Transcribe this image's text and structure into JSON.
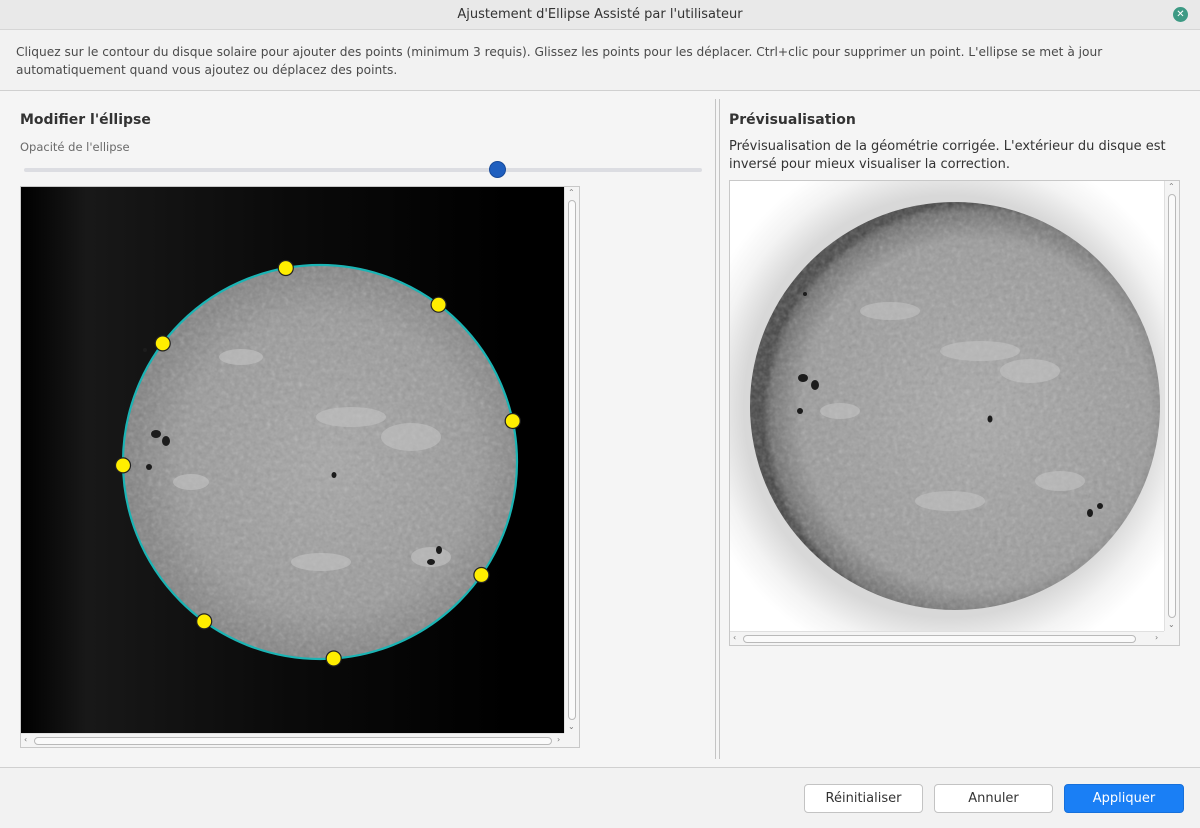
{
  "window": {
    "title": "Ajustement d'Ellipse Assisté par l'utilisateur",
    "close_glyph": "✕"
  },
  "instructions": "Cliquez sur le contour du disque solaire pour ajouter des points (minimum 3 requis). Glissez les points pour les déplacer. Ctrl+clic pour supprimer un point. L'ellipse se met à jour automatiquement quand vous ajoutez ou déplacez des points.",
  "left_panel": {
    "title": "Modifier l'éllipse",
    "opacity_label": "Opacité de l'ellipse",
    "opacity_value": 0.7,
    "ellipse_color": "#1bb4b4",
    "point_color": "#ffee00",
    "point_count": 8
  },
  "right_panel": {
    "title": "Prévisualisation",
    "description": "Prévisualisation de la géométrie corrigée. L'extérieur du disque est inversé pour mieux visualiser la correction."
  },
  "scroll_arrows": {
    "up": "⌃",
    "down": "⌄",
    "left": "‹",
    "right": "›"
  },
  "buttons": {
    "reset": "Réinitialiser",
    "cancel": "Annuler",
    "apply": "Appliquer"
  },
  "colors": {
    "accent": "#1a7ff5",
    "slider_handle": "#1f5fbf"
  }
}
